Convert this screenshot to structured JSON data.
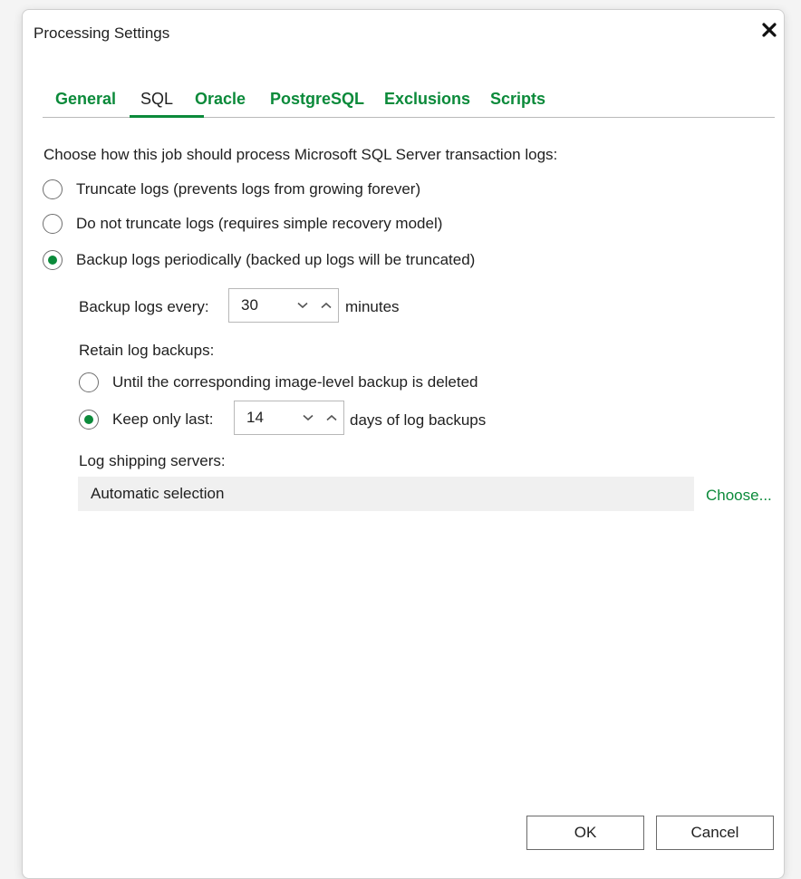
{
  "window": {
    "title": "Processing Settings"
  },
  "tabs": [
    {
      "label": "General",
      "active": false
    },
    {
      "label": "SQL",
      "active": true
    },
    {
      "label": "Oracle",
      "active": false
    },
    {
      "label": "PostgreSQL",
      "active": false
    },
    {
      "label": "Exclusions",
      "active": false
    },
    {
      "label": "Scripts",
      "active": false
    }
  ],
  "sql": {
    "intro": "Choose how this job should process Microsoft SQL Server transaction logs:",
    "options": [
      {
        "label": "Truncate logs (prevents logs from growing forever)",
        "checked": false
      },
      {
        "label": "Do not truncate logs (requires simple recovery model)",
        "checked": false
      },
      {
        "label": "Backup logs periodically (backed up logs will be truncated)",
        "checked": true
      }
    ],
    "backup_every": {
      "label": "Backup logs every:",
      "value": "30",
      "unit": "minutes"
    },
    "retain": {
      "label": "Retain log backups:",
      "options": [
        {
          "label": "Until the corresponding image-level backup is deleted",
          "checked": false
        },
        {
          "label": "Keep only last:",
          "checked": true
        }
      ],
      "keep_value": "14",
      "keep_unit": "days of log backups"
    },
    "log_shipping": {
      "label": "Log shipping servers:",
      "value": "Automatic selection",
      "choose_label": "Choose..."
    }
  },
  "buttons": {
    "ok": "OK",
    "cancel": "Cancel"
  },
  "colors": {
    "accent": "#0b8a3a",
    "text": "#1f1f1f",
    "border": "#b8b8b8",
    "field_bg": "#f0f0f0"
  },
  "icons": {
    "close": "close-icon",
    "spin_down": "chevron-down-icon",
    "spin_up": "chevron-up-icon"
  }
}
